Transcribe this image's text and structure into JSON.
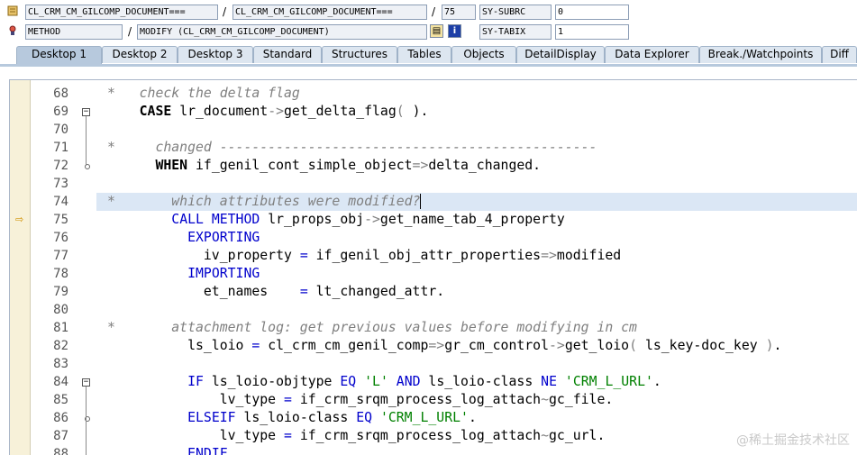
{
  "header": {
    "row1": {
      "field1": "CL_CRM_CM_GILCOMP_DOCUMENT===",
      "sep1": "/",
      "field2": "CL_CRM_CM_GILCOMP_DOCUMENT===",
      "sep2": "/",
      "line_no": "75",
      "sysvar_name": "SY-SUBRC",
      "sysvar_value": "0"
    },
    "row2": {
      "icon": "debug-icon",
      "event_type": "METHOD",
      "sep": "/",
      "event_name": "MODIFY (CL_CRM_CM_GILCOMP_DOCUMENT)",
      "sysvar_name": "SY-TABIX",
      "sysvar_value": "1"
    }
  },
  "tabs": [
    {
      "label": "Desktop 1",
      "active": true
    },
    {
      "label": "Desktop 2",
      "active": false
    },
    {
      "label": "Desktop 3",
      "active": false
    },
    {
      "label": "Standard",
      "active": false
    },
    {
      "label": "Structures",
      "active": false
    },
    {
      "label": "Tables",
      "active": false
    },
    {
      "label": "Objects",
      "active": false
    },
    {
      "label": "DetailDisplay",
      "active": false
    },
    {
      "label": "Data Explorer",
      "active": false
    },
    {
      "label": "Break./Watchpoints",
      "active": false
    },
    {
      "label": "Diff",
      "active": false
    }
  ],
  "editor": {
    "current_line": "75",
    "lines": [
      {
        "no": "68",
        "fold": "",
        "seg": [
          {
            "t": "*   check the delta flag",
            "c": "cm"
          }
        ]
      },
      {
        "no": "69",
        "fold": "box",
        "seg": [
          {
            "t": "    "
          },
          {
            "t": "CASE",
            "c": "kwb"
          },
          {
            "t": " lr_document"
          },
          {
            "t": "->",
            "c": "op"
          },
          {
            "t": "get_delta_flag"
          },
          {
            "t": "( ",
            "c": "op"
          },
          {
            "t": ")."
          }
        ]
      },
      {
        "no": "70",
        "fold": "",
        "seg": []
      },
      {
        "no": "71",
        "fold": "",
        "seg": [
          {
            "t": "*     changed -----------------------------------------------",
            "c": "cm"
          }
        ]
      },
      {
        "no": "72",
        "fold": "dot",
        "seg": [
          {
            "t": "      "
          },
          {
            "t": "WHEN",
            "c": "kwb"
          },
          {
            "t": " if_genil_cont_simple_object"
          },
          {
            "t": "=>",
            "c": "op"
          },
          {
            "t": "delta_changed."
          }
        ]
      },
      {
        "no": "73",
        "fold": "",
        "seg": []
      },
      {
        "no": "74",
        "fold": "",
        "hl": true,
        "seg": [
          {
            "t": "*       which attributes were modified?",
            "c": "cm"
          }
        ]
      },
      {
        "no": "75",
        "fold": "",
        "seg": [
          {
            "t": "        "
          },
          {
            "t": "CALL METHOD",
            "c": "kw"
          },
          {
            "t": " lr_props_obj"
          },
          {
            "t": "->",
            "c": "op"
          },
          {
            "t": "get_name_tab_4_property"
          }
        ]
      },
      {
        "no": "76",
        "fold": "",
        "seg": [
          {
            "t": "          "
          },
          {
            "t": "EXPORTING",
            "c": "kw"
          }
        ]
      },
      {
        "no": "77",
        "fold": "",
        "seg": [
          {
            "t": "            iv_property "
          },
          {
            "t": "=",
            "c": "kw"
          },
          {
            "t": " if_genil_obj_attr_properties"
          },
          {
            "t": "=>",
            "c": "op"
          },
          {
            "t": "modified"
          }
        ]
      },
      {
        "no": "78",
        "fold": "",
        "seg": [
          {
            "t": "          "
          },
          {
            "t": "IMPORTING",
            "c": "kw"
          }
        ]
      },
      {
        "no": "79",
        "fold": "",
        "seg": [
          {
            "t": "            et_names    "
          },
          {
            "t": "=",
            "c": "kw"
          },
          {
            "t": " lt_changed_attr."
          }
        ]
      },
      {
        "no": "80",
        "fold": "",
        "seg": []
      },
      {
        "no": "81",
        "fold": "",
        "seg": [
          {
            "t": "*       attachment log: get previous values before modifying in cm",
            "c": "cm"
          }
        ]
      },
      {
        "no": "82",
        "fold": "",
        "seg": [
          {
            "t": "          ls_loio "
          },
          {
            "t": "=",
            "c": "kw"
          },
          {
            "t": " cl_crm_cm_genil_comp"
          },
          {
            "t": "=>",
            "c": "op"
          },
          {
            "t": "gr_cm_control"
          },
          {
            "t": "->",
            "c": "op"
          },
          {
            "t": "get_loio"
          },
          {
            "t": "( ",
            "c": "op"
          },
          {
            "t": "ls_key-doc_key "
          },
          {
            "t": ")",
            "c": "op"
          },
          {
            "t": "."
          }
        ]
      },
      {
        "no": "83",
        "fold": "",
        "seg": []
      },
      {
        "no": "84",
        "fold": "box",
        "seg": [
          {
            "t": "          "
          },
          {
            "t": "IF",
            "c": "kw"
          },
          {
            "t": " ls_loio-objtype "
          },
          {
            "t": "EQ",
            "c": "kw"
          },
          {
            "t": " "
          },
          {
            "t": "'L'",
            "c": "str"
          },
          {
            "t": " "
          },
          {
            "t": "AND",
            "c": "kw"
          },
          {
            "t": " ls_loio-class "
          },
          {
            "t": "NE",
            "c": "kw"
          },
          {
            "t": " "
          },
          {
            "t": "'CRM_L_URL'",
            "c": "str"
          },
          {
            "t": "."
          }
        ]
      },
      {
        "no": "85",
        "fold": "",
        "seg": [
          {
            "t": "              lv_type "
          },
          {
            "t": "=",
            "c": "kw"
          },
          {
            "t": " if_crm_srqm_process_log_attach"
          },
          {
            "t": "~",
            "c": "op"
          },
          {
            "t": "gc_file."
          }
        ]
      },
      {
        "no": "86",
        "fold": "dot",
        "seg": [
          {
            "t": "          "
          },
          {
            "t": "ELSEIF",
            "c": "kw"
          },
          {
            "t": " ls_loio-class "
          },
          {
            "t": "EQ",
            "c": "kw"
          },
          {
            "t": " "
          },
          {
            "t": "'CRM_L_URL'",
            "c": "str"
          },
          {
            "t": "."
          }
        ]
      },
      {
        "no": "87",
        "fold": "",
        "seg": [
          {
            "t": "              lv_type "
          },
          {
            "t": "=",
            "c": "kw"
          },
          {
            "t": " if_crm_srqm_process_log_attach"
          },
          {
            "t": "~",
            "c": "op"
          },
          {
            "t": "gc_url."
          }
        ]
      },
      {
        "no": "88",
        "fold": "",
        "seg": [
          {
            "t": "          "
          },
          {
            "t": "ENDIF",
            "c": "kw"
          },
          {
            "t": "."
          }
        ]
      }
    ]
  },
  "watermark": "@稀土掘金技术社区",
  "colors": {
    "keyword": "#0000cc",
    "comment": "#7f7f7f",
    "string": "#008000",
    "tab_active": "#b7c9dd",
    "tab_inactive": "#dde6f0",
    "breakpoint_bar": "#f7f1d9",
    "current_line_arrow": "#d09000"
  }
}
